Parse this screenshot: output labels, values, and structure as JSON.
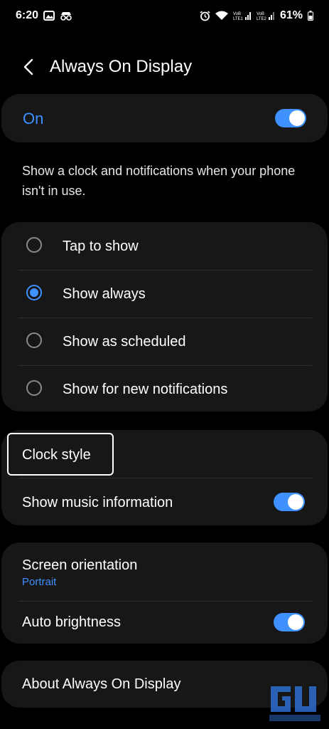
{
  "status_bar": {
    "time": "6:20",
    "left_icons": [
      "gallery-icon",
      "incognito-icon"
    ],
    "right_icons": [
      "alarm-icon",
      "wifi-icon",
      "signal-lte1-icon",
      "signal-lte2-icon",
      "battery-icon"
    ],
    "signal1_text": "VoB LTE1",
    "signal2_text": "VoB LTE2",
    "battery_percent": "61%"
  },
  "header": {
    "title": "Always On Display"
  },
  "master": {
    "label": "On",
    "toggle_on": true
  },
  "description": "Show a clock and notifications when your phone isn't in use.",
  "display_mode": {
    "options": [
      {
        "label": "Tap to show",
        "selected": false
      },
      {
        "label": "Show always",
        "selected": true
      },
      {
        "label": "Show as scheduled",
        "selected": false
      },
      {
        "label": "Show for new notifications",
        "selected": false
      }
    ]
  },
  "clock_section": {
    "clock_style_label": "Clock style",
    "music_label": "Show music information",
    "music_toggle_on": true
  },
  "screen_section": {
    "orientation_label": "Screen orientation",
    "orientation_value": "Portrait",
    "brightness_label": "Auto brightness",
    "brightness_toggle_on": true
  },
  "about": {
    "label": "About Always On Display"
  },
  "colors": {
    "accent": "#3e91ff",
    "card_bg": "#171717",
    "background": "#000000"
  }
}
